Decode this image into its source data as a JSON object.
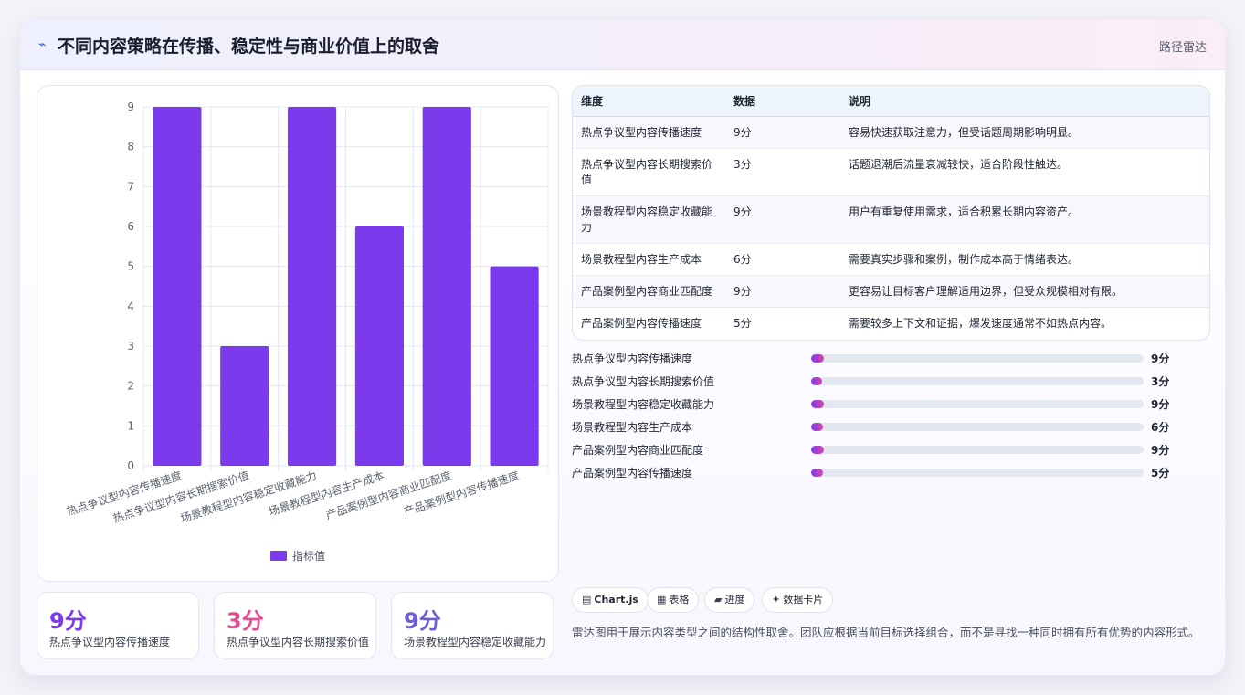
{
  "header": {
    "icon": "route-icon",
    "title": "不同内容策略在传播、稳定性与商业价值上的取舍",
    "link": "路径雷达"
  },
  "chart_data": {
    "type": "bar",
    "categories": [
      "热点争议型内容传播速度",
      "热点争议型内容长期搜索价值",
      "场景教程型内容稳定收藏能力",
      "场景教程型内容生产成本",
      "产品案例型内容商业匹配度",
      "产品案例型内容传播速度"
    ],
    "series": [
      {
        "name": "指标值",
        "values": [
          9,
          3,
          9,
          6,
          9,
          5
        ],
        "color": "#7c3aed"
      }
    ],
    "ylim": [
      0,
      9
    ],
    "yticks": [
      "0",
      "1",
      "2",
      "3",
      "4",
      "5",
      "6",
      "7",
      "8",
      "9"
    ],
    "grid": true,
    "legend": "bottom"
  },
  "stats": [
    {
      "value": "9分",
      "label": "热点争议型内容传播速度",
      "color": "#7c3aed"
    },
    {
      "value": "3分",
      "label": "热点争议型内容长期搜索价值",
      "color": "#e64a8f"
    },
    {
      "value": "9分",
      "label": "场景教程型内容稳定收藏能力",
      "color": "#6d5bd8"
    }
  ],
  "table": {
    "headers": [
      "维度",
      "数据",
      "说明"
    ],
    "rows": [
      [
        "热点争议型内容传播速度",
        "9分",
        "容易快速获取注意力，但受话题周期影响明显。"
      ],
      [
        "热点争议型内容长期搜索价值",
        "3分",
        "话题退潮后流量衰减较快，适合阶段性触达。"
      ],
      [
        "场景教程型内容稳定收藏能力",
        "9分",
        "用户有重复使用需求，适合积累长期内容资产。"
      ],
      [
        "场景教程型内容生产成本",
        "6分",
        "需要真实步骤和案例，制作成本高于情绪表达。"
      ],
      [
        "产品案例型内容商业匹配度",
        "9分",
        "更容易让目标客户理解适用边界，但受众规模相对有限。"
      ],
      [
        "产品案例型内容传播速度",
        "5分",
        "需要较多上下文和证据，爆发速度通常不如热点内容。"
      ]
    ]
  },
  "progress": [
    {
      "label": "热点争议型内容传播速度",
      "value": "9分"
    },
    {
      "label": "热点争议型内容长期搜索价值",
      "value": "3分"
    },
    {
      "label": "场景教程型内容稳定收藏能力",
      "value": "9分"
    },
    {
      "label": "场景教程型内容生产成本",
      "value": "6分"
    },
    {
      "label": "产品案例型内容商业匹配度",
      "value": "9分"
    },
    {
      "label": "产品案例型内容传播速度",
      "value": "5分"
    }
  ],
  "chips": [
    {
      "icon": "chart-icon",
      "glyph": "▤",
      "label": "Chart.js"
    },
    {
      "icon": "table-icon",
      "glyph": "▦",
      "label": "表格"
    },
    {
      "icon": "progress-icon",
      "glyph": "▰",
      "label": "进度"
    },
    {
      "icon": "sparkle-icon",
      "glyph": "✦",
      "label": "数据卡片"
    }
  ],
  "footnote": "雷达图用于展示内容类型之间的结构性取舍。团队应根据当前目标选择组合，而不是寻找一种同时拥有所有优势的内容形式。"
}
